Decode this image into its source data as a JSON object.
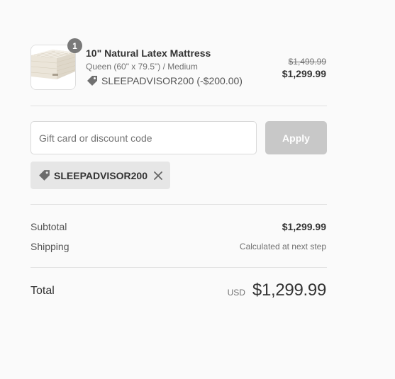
{
  "product": {
    "quantity": "1",
    "title": "10\" Natural Latex Mattress",
    "variant": "Queen (60\" x 79.5\") / Medium",
    "discount_line": "SLEEPADVISOR200 (-$200.00)",
    "original_price": "$1,499.99",
    "price": "$1,299.99",
    "image_icon": "mattress-image"
  },
  "discount": {
    "placeholder": "Gift card or discount code",
    "value": "",
    "apply_label": "Apply",
    "applied_code": "SLEEPADVISOR200"
  },
  "summary": {
    "subtotal_label": "Subtotal",
    "subtotal_value": "$1,299.99",
    "shipping_label": "Shipping",
    "shipping_value": "Calculated at next step",
    "total_label": "Total",
    "currency": "USD",
    "total_value": "$1,299.99"
  },
  "colors": {
    "background": "#fafafa",
    "apply_button_disabled": "#c8c8c8",
    "chip_background": "#e6e6e6",
    "badge": "#727272",
    "text": "#333333",
    "muted": "#717171"
  }
}
